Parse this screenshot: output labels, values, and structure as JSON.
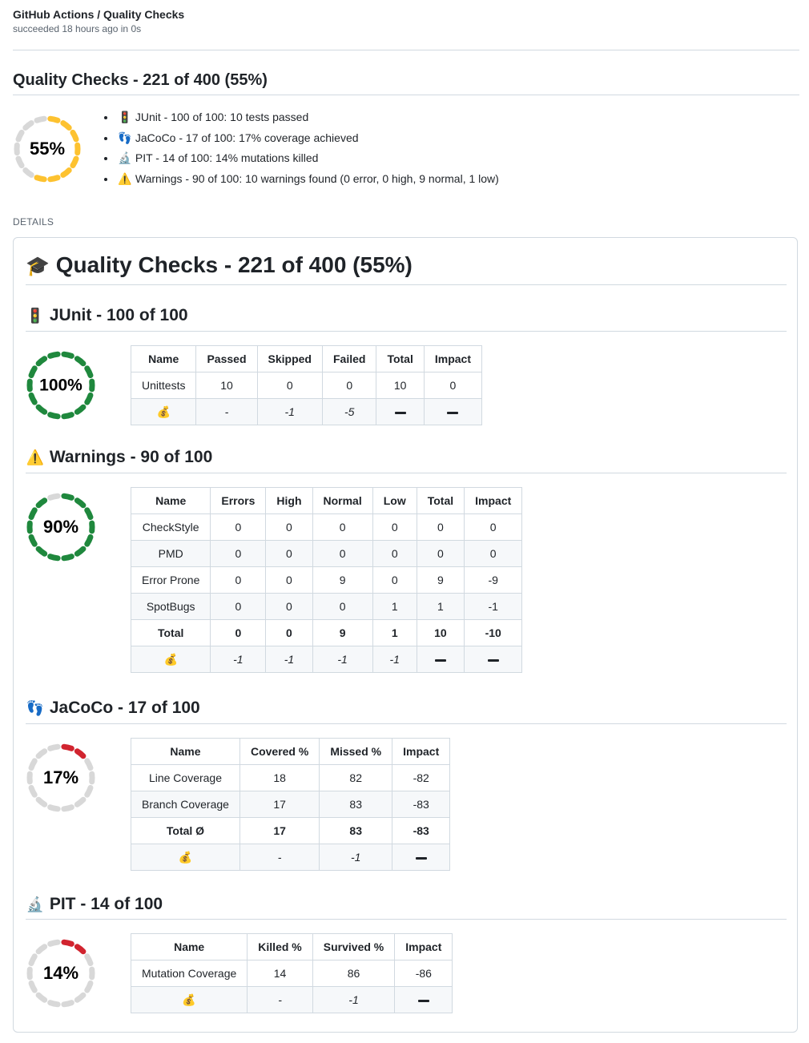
{
  "header": {
    "title": "GitHub Actions / Quality Checks",
    "subtitle": "succeeded 18 hours ago in 0s"
  },
  "summary": {
    "title": "Quality Checks - 221 of 400 (55%)",
    "gauge": {
      "label": "55%",
      "percent": 55,
      "color": "#fdc230"
    },
    "items": [
      {
        "icon": "traffic-light",
        "emoji": "🚦",
        "text": "JUnit - 100 of 100: 10 tests passed"
      },
      {
        "icon": "footprints",
        "emoji": "👣",
        "text": "JaCoCo - 17 of 100: 17% coverage achieved"
      },
      {
        "icon": "microscope",
        "emoji": "🔬",
        "text": "PIT - 14 of 100: 14% mutations killed"
      },
      {
        "icon": "warning",
        "emoji": "⚠️",
        "text": "Warnings - 90 of 100: 10 warnings found (0 error, 0 high, 9 normal, 1 low)"
      }
    ]
  },
  "details_label": "DETAILS",
  "details": {
    "title_emoji": "🎓",
    "title": "Quality Checks - 221 of 400 (55%)",
    "sections": [
      {
        "id": "junit",
        "icon": "traffic-light",
        "emoji": "🚦",
        "heading": "JUnit - 100 of 100",
        "gauge": {
          "label": "100%",
          "percent": 100,
          "color": "#1f883d"
        },
        "columns": [
          "Name",
          "Passed",
          "Skipped",
          "Failed",
          "Total",
          "Impact"
        ],
        "rows": [
          [
            "Unittests",
            "10",
            "0",
            "0",
            "10",
            "0"
          ]
        ],
        "total_row": null,
        "money_row": [
          "💰",
          "-",
          "-1",
          "-5",
          "dash",
          "dash"
        ]
      },
      {
        "id": "warnings",
        "icon": "warning",
        "emoji": "⚠️",
        "heading": "Warnings - 90 of 100",
        "gauge": {
          "label": "90%",
          "percent": 90,
          "color": "#1f883d"
        },
        "columns": [
          "Name",
          "Errors",
          "High",
          "Normal",
          "Low",
          "Total",
          "Impact"
        ],
        "rows": [
          [
            "CheckStyle",
            "0",
            "0",
            "0",
            "0",
            "0",
            "0"
          ],
          [
            "PMD",
            "0",
            "0",
            "0",
            "0",
            "0",
            "0"
          ],
          [
            "Error Prone",
            "0",
            "0",
            "9",
            "0",
            "9",
            "-9"
          ],
          [
            "SpotBugs",
            "0",
            "0",
            "0",
            "1",
            "1",
            "-1"
          ]
        ],
        "total_row": [
          "Total",
          "0",
          "0",
          "9",
          "1",
          "10",
          "-10"
        ],
        "money_row": [
          "💰",
          "-1",
          "-1",
          "-1",
          "-1",
          "dash",
          "dash"
        ]
      },
      {
        "id": "jacoco",
        "icon": "footprints",
        "emoji": "👣",
        "heading": "JaCoCo - 17 of 100",
        "gauge": {
          "label": "17%",
          "percent": 17,
          "color": "#d1242f"
        },
        "columns": [
          "Name",
          "Covered %",
          "Missed %",
          "Impact"
        ],
        "rows": [
          [
            "Line Coverage",
            "18",
            "82",
            "-82"
          ],
          [
            "Branch Coverage",
            "17",
            "83",
            "-83"
          ]
        ],
        "total_row": [
          "Total Ø",
          "17",
          "83",
          "-83"
        ],
        "money_row": [
          "💰",
          "-",
          "-1",
          "dash"
        ]
      },
      {
        "id": "pit",
        "icon": "microscope",
        "emoji": "🔬",
        "heading": "PIT - 14 of 100",
        "gauge": {
          "label": "14%",
          "percent": 14,
          "color": "#d1242f"
        },
        "columns": [
          "Name",
          "Killed %",
          "Survived %",
          "Impact"
        ],
        "rows": [
          [
            "Mutation Coverage",
            "14",
            "86",
            "-86"
          ]
        ],
        "total_row": null,
        "money_row": [
          "💰",
          "-",
          "-1",
          "dash"
        ]
      }
    ]
  }
}
